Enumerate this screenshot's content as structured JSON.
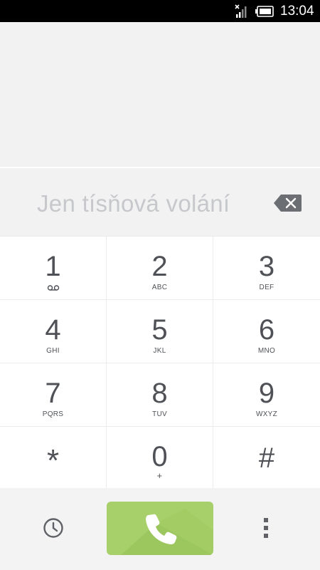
{
  "status_bar": {
    "time": "13:04",
    "signal_icon": "no-signal-icon",
    "battery_icon": "battery-icon"
  },
  "display": {
    "hint": "Jen tísňová volání",
    "backspace_icon": "backspace-icon"
  },
  "keypad": {
    "keys": [
      {
        "digit": "1",
        "letters": "",
        "icon": "voicemail-icon"
      },
      {
        "digit": "2",
        "letters": "ABC"
      },
      {
        "digit": "3",
        "letters": "DEF"
      },
      {
        "digit": "4",
        "letters": "GHI"
      },
      {
        "digit": "5",
        "letters": "JKL"
      },
      {
        "digit": "6",
        "letters": "MNO"
      },
      {
        "digit": "7",
        "letters": "PQRS"
      },
      {
        "digit": "8",
        "letters": "TUV"
      },
      {
        "digit": "9",
        "letters": "WXYZ"
      },
      {
        "digit": "*",
        "letters": ""
      },
      {
        "digit": "0",
        "letters": "+"
      },
      {
        "digit": "#",
        "letters": ""
      }
    ]
  },
  "bottom_bar": {
    "history_icon": "clock-icon",
    "call_icon": "phone-icon",
    "more_icon": "overflow-menu-icon",
    "call_button_color": "#a8d06a"
  },
  "colors": {
    "background": "#f2f2f3",
    "key_background": "#ffffff",
    "digit_text": "#4f5156",
    "hint_text": "#c7c8cb",
    "status_bar": "#000000"
  }
}
